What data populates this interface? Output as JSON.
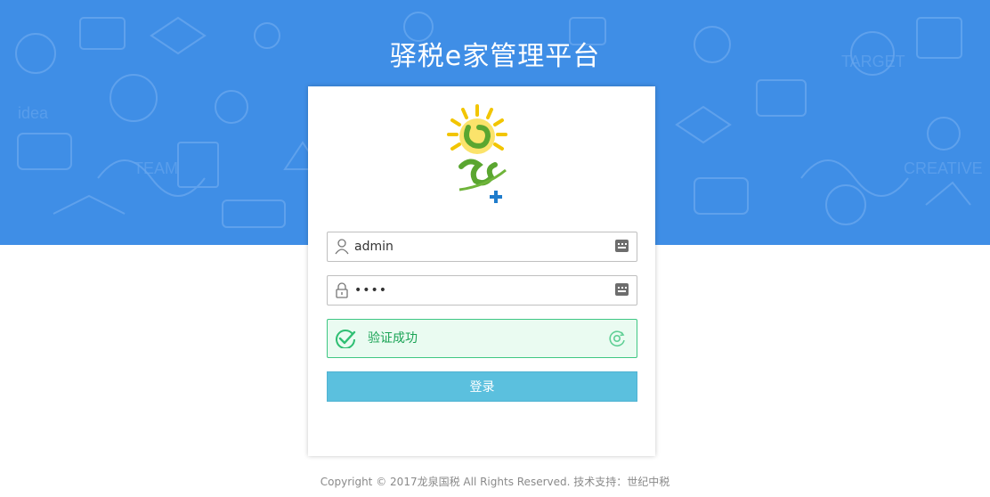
{
  "header": {
    "title": "驿税e家管理平台"
  },
  "login": {
    "username": {
      "value": "admin",
      "icon": "user-icon",
      "trailing_icon": "keyboard-icon"
    },
    "password": {
      "masked_value": "••••",
      "icon": "lock-icon",
      "trailing_icon": "keyboard-icon"
    },
    "verification": {
      "text": "验证成功",
      "status_icon": "check-circle-icon",
      "refresh_icon": "refresh-icon"
    },
    "submit_label": "登录"
  },
  "footer": {
    "copyright_label": "Copyright",
    "symbol": "©",
    "text": "2017龙泉国税 All Rights Reserved. 技术支持：世纪中税"
  },
  "colors": {
    "banner": "#3f8ee6",
    "button": "#5bc0de",
    "success": "#1aa355",
    "success_bg": "#eafbf1"
  }
}
